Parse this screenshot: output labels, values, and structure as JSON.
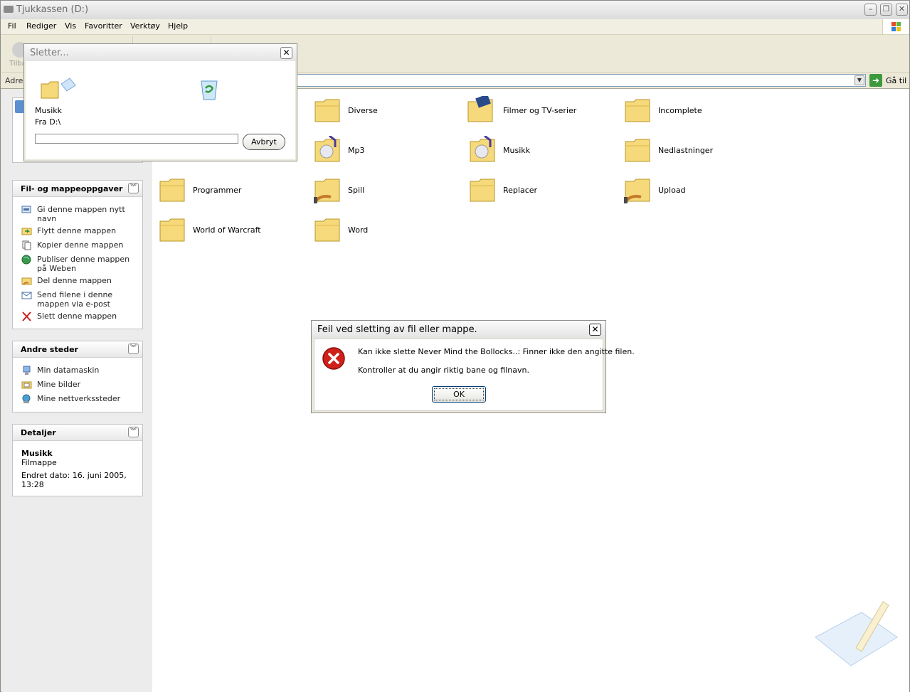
{
  "window": {
    "title": "Tjukkassen (D:)"
  },
  "menu": [
    "Fil",
    "Rediger",
    "Vis",
    "Favoritter",
    "Verktøy",
    "Hjelp"
  ],
  "toolbar": {
    "back_label": "Tilba"
  },
  "address": {
    "label": "Adres",
    "go_label": "Gå til"
  },
  "panels": {
    "tasks": {
      "title": "Fil- og mappeoppgaver",
      "items": [
        "Gi denne mappen nytt navn",
        "Flytt denne mappen",
        "Kopier denne mappen",
        "Publiser denne mappen på Weben",
        "Del denne mappen",
        "Send filene i denne mappen via e-post",
        "Slett denne mappen"
      ]
    },
    "places": {
      "title": "Andre steder",
      "items": [
        "Min datamaskin",
        "Mine bilder",
        "Mine nettverkssteder"
      ]
    },
    "details": {
      "title": "Detaljer",
      "name": "Musikk",
      "type": "Filmappe",
      "modified": "Endret dato: 16. juni 2005, 13:28"
    }
  },
  "folders": [
    "Diverse",
    "Filmer og TV-serier",
    "Incomplete",
    "Mp3",
    "Musikk",
    "Nedlastninger",
    "Programmer",
    "Spill",
    "Replacer",
    "Upload",
    "World of Warcraft",
    "Word"
  ],
  "deleting_dialog": {
    "title": "Sletter...",
    "item_name": "Musikk",
    "from_text": "Fra D:\\",
    "cancel_label": "Avbryt",
    "progress": 0
  },
  "error_dialog": {
    "title": "Feil ved sletting av fil eller mappe.",
    "message": "Kan ikke slette Never Mind the Bollocks..: Finner ikke den angitte filen.",
    "hint": "Kontroller at du angir riktig bane og filnavn.",
    "ok_label": "OK"
  },
  "colors": {
    "folder": "#f5d97a",
    "error_red": "#d0201a",
    "task_link": "#222222"
  }
}
